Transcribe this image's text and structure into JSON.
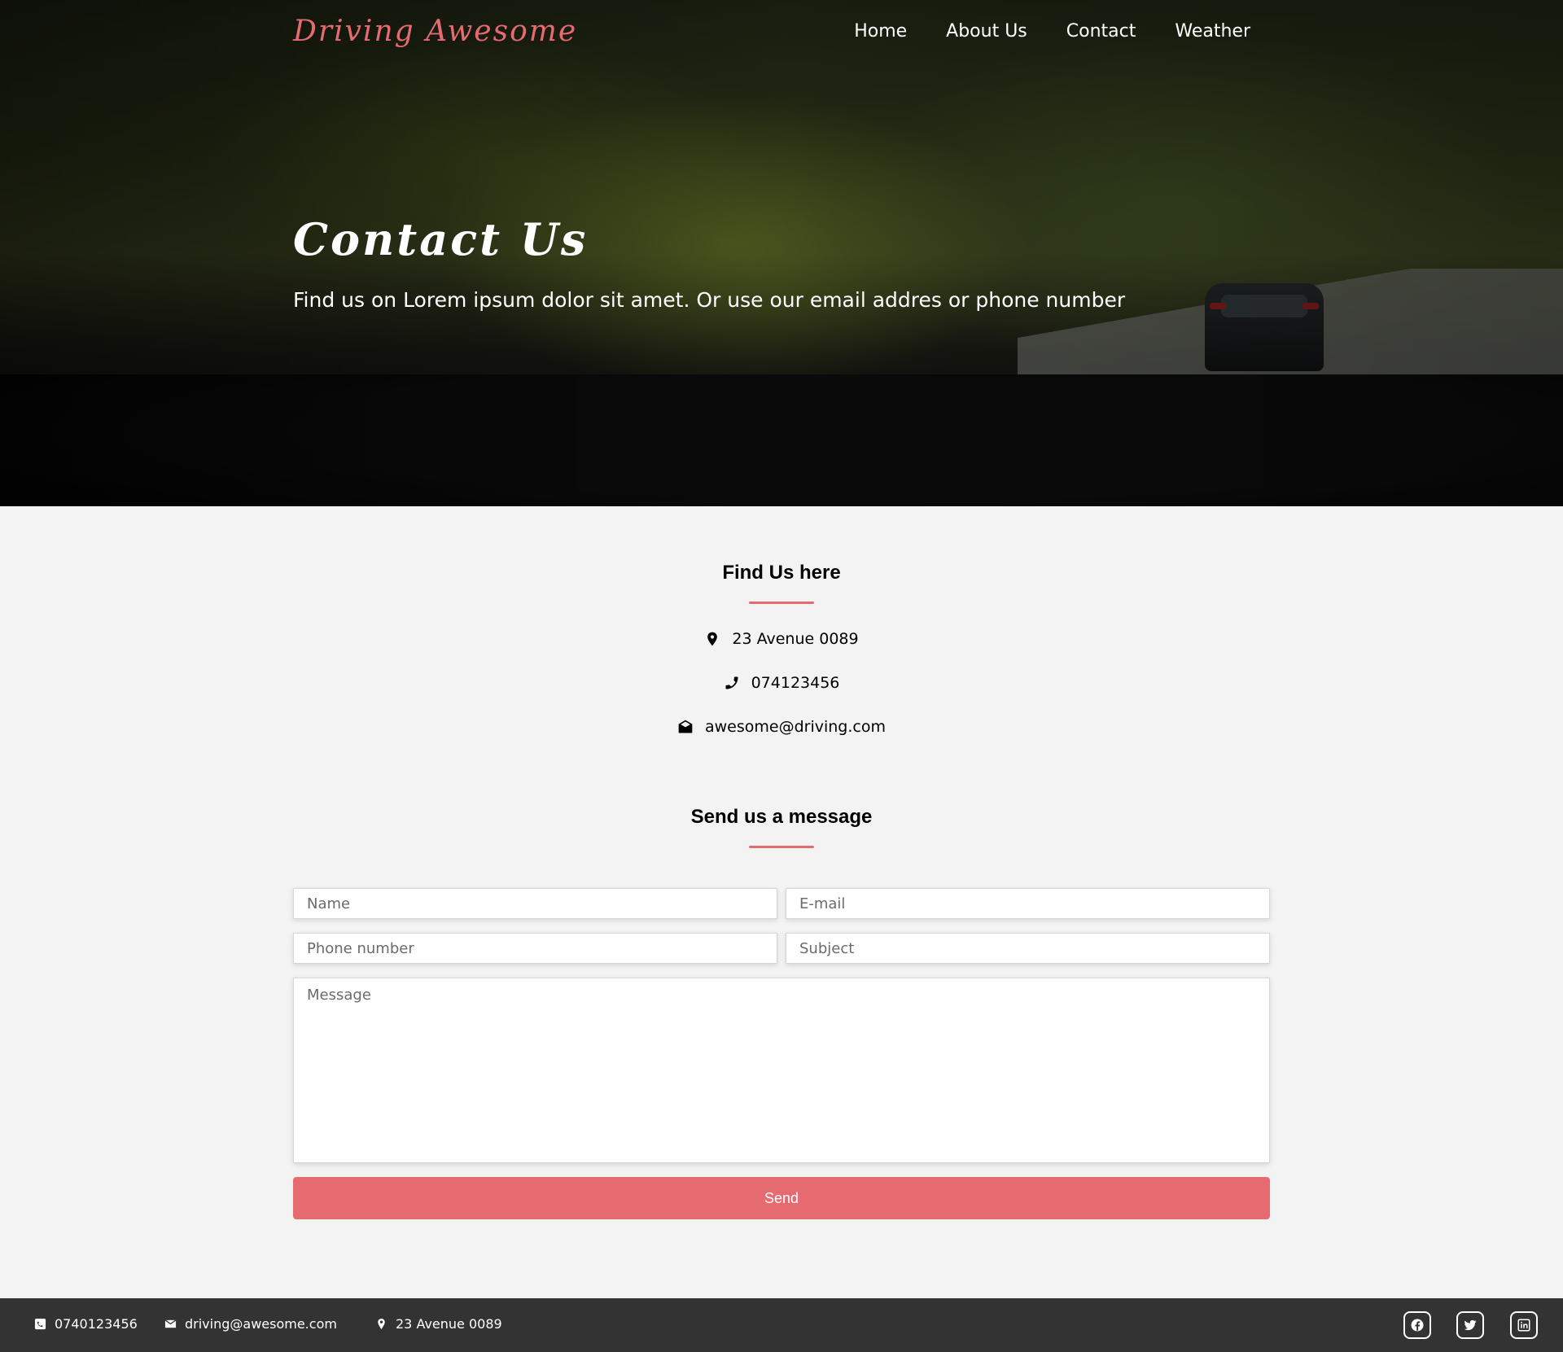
{
  "brand": "Driving Awesome",
  "nav": {
    "items": [
      "Home",
      "About Us",
      "Contact",
      "Weather"
    ]
  },
  "hero": {
    "title": "Contact Us",
    "subtitle": "Find us on Lorem ipsum dolor sit amet. Or use our email addres or phone number"
  },
  "find_us": {
    "title": "Find Us here",
    "address": "23 Avenue 0089",
    "phone": "074123456",
    "email": "awesome@driving.com"
  },
  "message_form": {
    "title": "Send us a message",
    "name_placeholder": "Name",
    "email_placeholder": "E-mail",
    "phone_placeholder": "Phone number",
    "subject_placeholder": "Subject",
    "message_placeholder": "Message",
    "send_label": "Send"
  },
  "footer": {
    "phone": "0740123456",
    "email": "driving@awesome.com",
    "address": "23 Avenue 0089",
    "social": [
      "facebook-icon",
      "twitter-icon",
      "linkedin-icon"
    ]
  },
  "colors": {
    "accent": "#e56b70",
    "footer_bg": "#333333",
    "page_bg": "#f3f3f3"
  }
}
